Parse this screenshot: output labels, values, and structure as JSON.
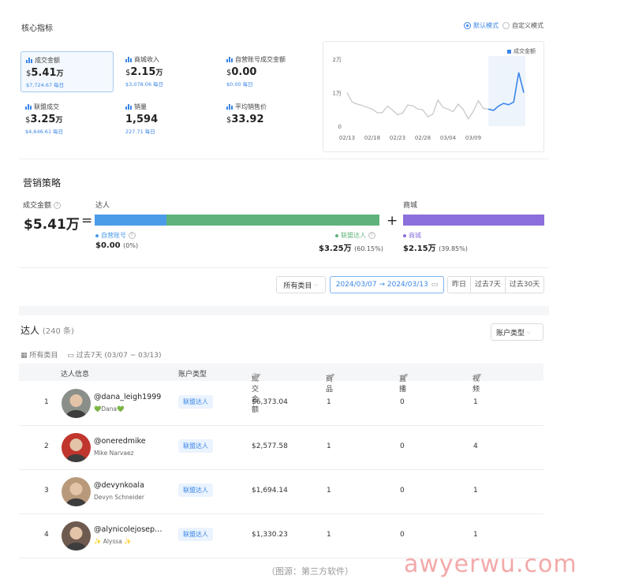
{
  "core": {
    "title": "核心指标",
    "mode_default": "默认模式",
    "mode_custom": "自定义模式",
    "metrics": [
      {
        "label": "成交金额",
        "currency": "$",
        "value": "5.41",
        "unit": "万",
        "sub": "$7,724.67 每日",
        "selected": true
      },
      {
        "label": "商城收入",
        "currency": "$",
        "value": "2.15",
        "unit": "万",
        "sub": "$3,078.06 每日"
      },
      {
        "label": "自营账号成交金额",
        "currency": "$",
        "value": "0.00",
        "unit": "",
        "sub": "$0.00 每日"
      },
      {
        "label": "联盟成交",
        "currency": "$",
        "value": "3.25",
        "unit": "万",
        "sub": "$4,646.61 每日"
      },
      {
        "label": "销量",
        "currency": "",
        "value": "1,594",
        "unit": "",
        "sub": "227.71 每日"
      },
      {
        "label": "平均销售价",
        "currency": "$",
        "value": "33.92",
        "unit": "",
        "sub": ""
      }
    ]
  },
  "chart_data": {
    "type": "line",
    "series": [
      {
        "name": "成交金额",
        "values": [
          10000,
          7200,
          6600,
          6200,
          5600,
          5100,
          4000,
          4100,
          6000,
          4800,
          3400,
          3900,
          6300,
          6100,
          5100,
          4900,
          2800,
          3600,
          7800,
          5600,
          5100,
          4300,
          6600,
          5000,
          2200,
          4400,
          7600,
          5300,
          5100,
          4700,
          6000,
          6800,
          6400,
          7200,
          16000,
          10000
        ]
      },
      {
        "name": "",
        "values": []
      }
    ],
    "x_ticks": [
      "02/13",
      "02/18",
      "02/23",
      "02/28",
      "03/04",
      "03/09"
    ],
    "y_ticks": [
      "0",
      "1万",
      "2万"
    ],
    "ylim": [
      0,
      20000
    ],
    "highlight_from_index": 28,
    "color": "#3a86e8"
  },
  "marketing": {
    "title": "营销策略",
    "gmv_label": "成交金额",
    "gmv_value": "$5.41万",
    "eq": "=",
    "plus": "+",
    "influencer_label": "达人",
    "mall_label": "商城",
    "self_label": "自营账号",
    "self_value": "$0.00",
    "self_pct": "(0%)",
    "aff_label": "联盟达人",
    "aff_value": "$3.25万",
    "aff_pct": "(60.15%)",
    "mall_legend": "商城",
    "mall_value": "$2.15万",
    "mall_pct": "(39.85%)",
    "colors": {
      "self": "#4a9be8",
      "aff": "#5fb37a",
      "mall": "#8b6fdc"
    },
    "aff_share": 0.6015
  },
  "filters": {
    "category": "所有类目",
    "date_range": "2024/03/07 → 2024/03/13",
    "yesterday": "昨日",
    "last7": "过去7天",
    "last30": "过去30天"
  },
  "influencers": {
    "title": "达人",
    "count": "(240 条)",
    "account_type_btn": "账户类型",
    "sub_category": "所有类目",
    "sub_range": "过去7天 (03/07 ~ 03/13)",
    "headers": [
      "达人信息",
      "账户类型",
      "成交金额",
      "商品",
      "直播",
      "视频"
    ],
    "rows": [
      {
        "rank": "1",
        "handle": "@dana_leigh1999",
        "nick": "💚Dana💚",
        "type": "联盟达人",
        "gmv": "$6,373.04",
        "products": "1",
        "live": "0",
        "video": "1",
        "avatar_bg": "#8a8f8a"
      },
      {
        "rank": "2",
        "handle": "@oneredmike",
        "nick": "Mike Narvaez",
        "type": "联盟达人",
        "gmv": "$2,577.58",
        "products": "1",
        "live": "0",
        "video": "4",
        "avatar_bg": "#c0352d"
      },
      {
        "rank": "3",
        "handle": "@devynkoala",
        "nick": "Devyn Schneider",
        "type": "联盟达人",
        "gmv": "$1,694.14",
        "products": "1",
        "live": "0",
        "video": "1",
        "avatar_bg": "#b89a7a"
      },
      {
        "rank": "4",
        "handle": "@alynicolejosep…",
        "nick": "✨ Alyssa ✨",
        "type": "联盟达人",
        "gmv": "$1,330.23",
        "products": "1",
        "live": "0",
        "video": "1",
        "avatar_bg": "#6e5a4f"
      }
    ]
  },
  "caption": "（图源：第三方软件）",
  "watermark": "awyerwu.com"
}
